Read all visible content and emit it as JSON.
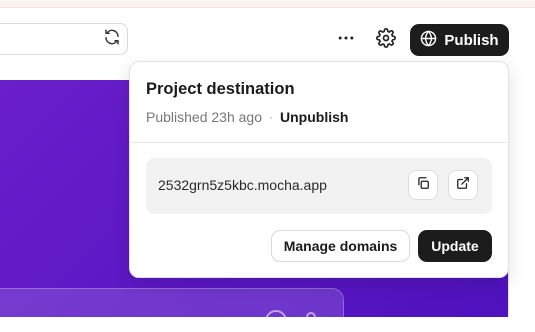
{
  "toolbar": {
    "refresh_icon": "refresh-icon",
    "more_icon": "more-horizontal-icon",
    "settings_icon": "gear-icon",
    "publish_label": "Publish",
    "publish_icon": "globe-icon"
  },
  "popover": {
    "title": "Project destination",
    "status": "Published 23h ago",
    "separator": "·",
    "unpublish_label": "Unpublish",
    "domain": "2532grn5z5kbc.mocha.app",
    "copy_icon": "copy-icon",
    "open_icon": "external-link-icon",
    "manage_domains_label": "Manage domains",
    "update_label": "Update"
  },
  "colors": {
    "accent_dark": "#1c1c1c",
    "preview_purple": "#5a16c4"
  }
}
